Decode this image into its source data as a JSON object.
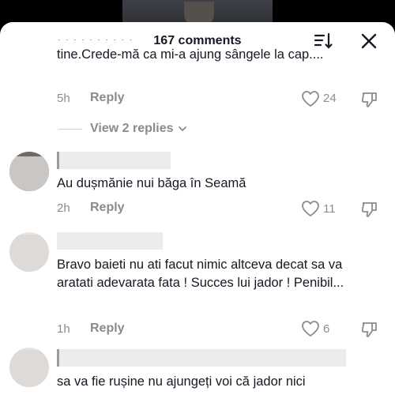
{
  "header": {
    "comment_count": "167 comments"
  },
  "comments": [
    {
      "text": "tine.Crede-mă ca mi-a ajung sângele la cap....",
      "time": "5h",
      "reply_label": "Reply",
      "likes": "24",
      "view_replies": "View 2 replies"
    },
    {
      "text": "Au dușmănie nui băga în Seamă",
      "time": "2h",
      "reply_label": "Reply",
      "likes": "11"
    },
    {
      "text": "Bravo baieti nu ati facut nimic altceva decat sa va aratati adevarata fata ! Succes lui jador ! Penibil...",
      "time": "1h",
      "reply_label": "Reply",
      "likes": "6"
    },
    {
      "text": "sa va fie rușine nu ajungeți voi că jador nici"
    }
  ],
  "icons": {
    "sort": "sort-icon",
    "close": "close-icon",
    "like": "heart-icon",
    "dislike": "dislike-icon",
    "chevron": "chevron-down-icon"
  },
  "colors": {
    "text": "#161823",
    "muted": "#8a8b91",
    "background": "#ffffff"
  }
}
